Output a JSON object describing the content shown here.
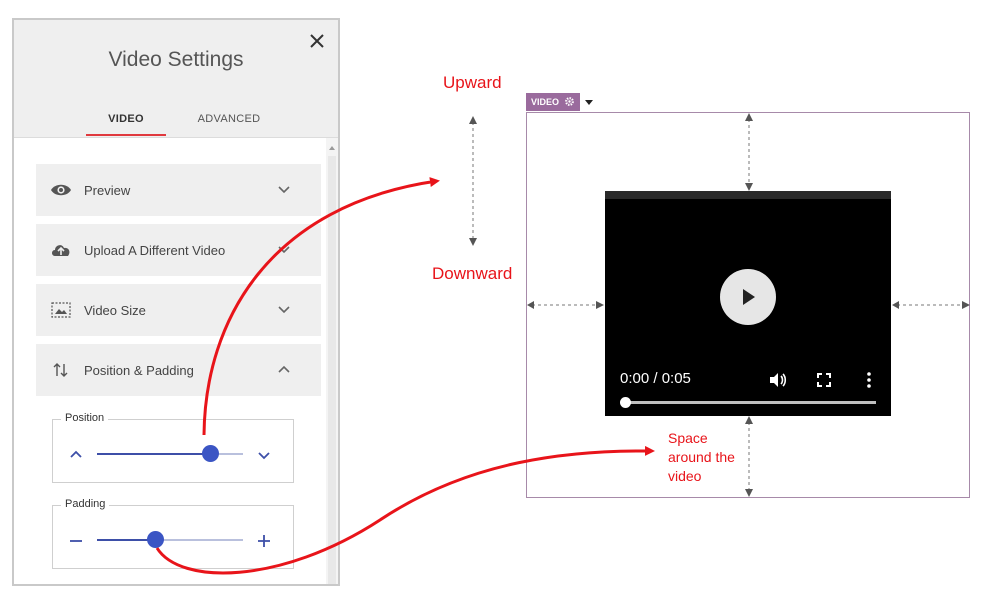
{
  "panel": {
    "title": "Video Settings",
    "tabs": [
      {
        "label": "VIDEO",
        "active": true
      },
      {
        "label": "ADVANCED",
        "active": false
      }
    ],
    "sections": [
      {
        "label": "Preview",
        "icon": "eye-icon",
        "expanded": false
      },
      {
        "label": "Upload A Different Video",
        "icon": "cloud-upload-icon",
        "expanded": false
      },
      {
        "label": "Video Size",
        "icon": "image-size-icon",
        "expanded": false
      },
      {
        "label": "Position & Padding",
        "icon": "vertical-arrows-icon",
        "expanded": true
      }
    ],
    "position": {
      "label": "Position",
      "value": 0.78
    },
    "padding": {
      "label": "Padding",
      "value": 0.4
    }
  },
  "annotations": {
    "upward": "Upward",
    "downward": "Downward",
    "space_line1": "Space",
    "space_line2": "around the",
    "space_line3": "video"
  },
  "module": {
    "tag": "VIDEO"
  },
  "player": {
    "time": "0:00 / 0:05",
    "progress": 0.0
  },
  "colors": {
    "accent_tab": "#e0393e",
    "slider": "#3b55c4",
    "annotation": "#e8141a",
    "module_tag": "#9a6b9d"
  }
}
